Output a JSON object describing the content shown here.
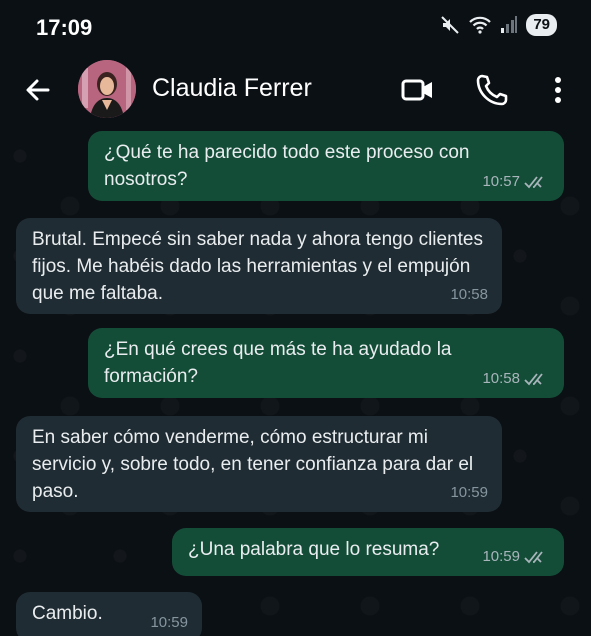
{
  "status_bar": {
    "time": "17:09",
    "battery": "79",
    "icons": [
      "mute-icon",
      "wifi-icon",
      "signal-icon",
      "battery-icon"
    ]
  },
  "header": {
    "contact_name": "Claudia Ferrer",
    "icons": [
      "back-arrow-icon",
      "video-call-icon",
      "phone-icon",
      "more-vert-icon"
    ]
  },
  "colors": {
    "background": "#0b1014",
    "outgoing_bubble": "#144d37",
    "incoming_bubble": "#202c33",
    "text": "#e9edef",
    "meta": "#a8b5bb"
  },
  "messages": [
    {
      "direction": "out",
      "text": "¿Qué te ha parecido todo este proceso con nosotros?",
      "time": "10:57",
      "read": true
    },
    {
      "direction": "in",
      "text": "Brutal. Empecé sin saber nada y ahora tengo clientes fijos. Me habéis dado las herramientas y el empujón que me faltaba.",
      "time": "10:58"
    },
    {
      "direction": "out",
      "text": "¿En qué crees que más te ha ayudado la formación?",
      "time": "10:58",
      "read": true
    },
    {
      "direction": "in",
      "text": "En saber cómo venderme, cómo estructurar mi servicio y, sobre todo, en tener confianza para dar el paso.",
      "time": "10:59"
    },
    {
      "direction": "out",
      "text": "¿Una palabra que lo resuma?",
      "time": "10:59",
      "read": true
    },
    {
      "direction": "in",
      "text": "Cambio.",
      "time": "10:59"
    }
  ]
}
